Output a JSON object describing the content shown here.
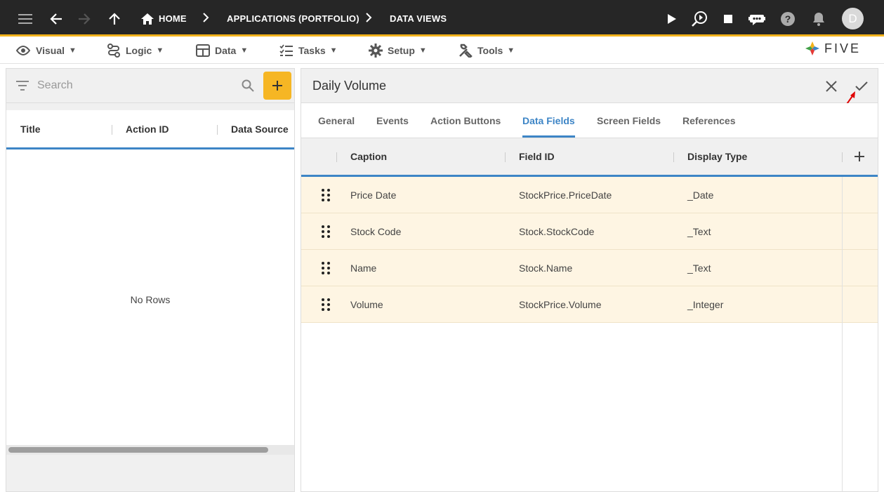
{
  "topbar": {
    "breadcrumbs": [
      "HOME",
      "APPLICATIONS (PORTFOLIO)",
      "DATA VIEWS"
    ],
    "avatar_letter": "D",
    "icons": [
      "menu-icon",
      "back-arrow-icon",
      "forward-arrow-icon",
      "up-arrow-icon",
      "home-icon",
      "play-icon",
      "debug-search-icon",
      "stop-icon",
      "chat-bot-icon",
      "help-icon",
      "bell-icon"
    ],
    "colors": {
      "background": "#262626",
      "accent": "#f2b21b"
    }
  },
  "menubar": {
    "items": [
      {
        "label": "Visual",
        "icon": "eye-icon"
      },
      {
        "label": "Logic",
        "icon": "logic-flow-icon"
      },
      {
        "label": "Data",
        "icon": "table-icon"
      },
      {
        "label": "Tasks",
        "icon": "checklist-icon"
      },
      {
        "label": "Setup",
        "icon": "gear-icon"
      },
      {
        "label": "Tools",
        "icon": "tools-icon"
      }
    ],
    "logo_text": "FIVE"
  },
  "left_panel": {
    "search": {
      "placeholder": "Search",
      "value": ""
    },
    "columns": [
      "Title",
      "Action ID",
      "Data Source"
    ],
    "empty_text": "No Rows"
  },
  "right_panel": {
    "title": "Daily Volume",
    "tabs": [
      "General",
      "Events",
      "Action Buttons",
      "Data Fields",
      "Screen Fields",
      "References"
    ],
    "active_tab": "Data Fields",
    "grid": {
      "columns": [
        "Caption",
        "Field ID",
        "Display Type"
      ],
      "rows": [
        {
          "caption": "Price Date",
          "field_id": "StockPrice.PriceDate",
          "display_type": "_Date"
        },
        {
          "caption": "Stock Code",
          "field_id": "Stock.StockCode",
          "display_type": "_Text"
        },
        {
          "caption": "Name",
          "field_id": "Stock.Name",
          "display_type": "_Text"
        },
        {
          "caption": "Volume",
          "field_id": "StockPrice.Volume",
          "display_type": "_Integer"
        }
      ]
    },
    "colors": {
      "active_tab": "#3d85c6",
      "row_background": "#fef5e3",
      "add_button": "#f6b624"
    }
  }
}
